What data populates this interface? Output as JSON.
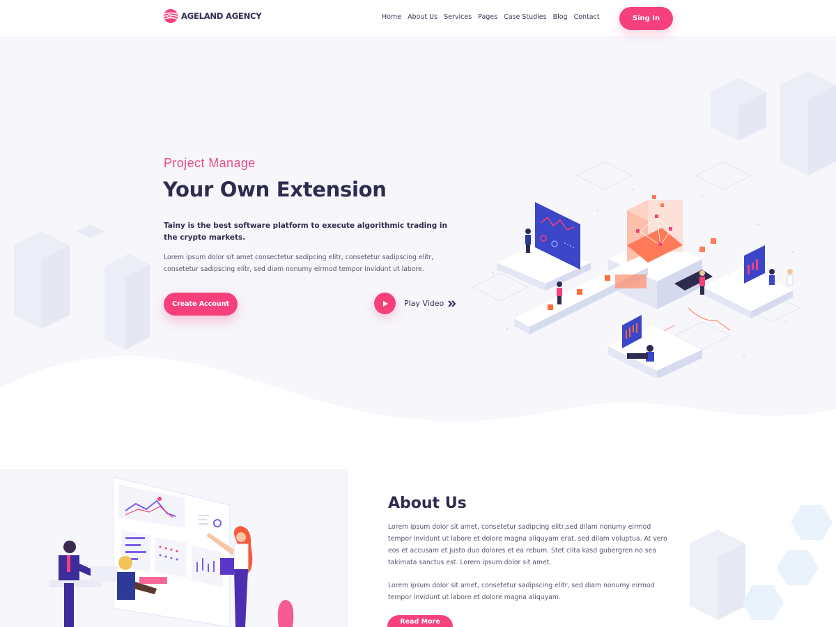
{
  "brand": {
    "name": "AGELAND AGENCY",
    "logo_icon": "globe-logo-icon",
    "accent": "#f5407c",
    "dark": "#2d2c4f"
  },
  "nav": {
    "items": [
      {
        "label": "Home"
      },
      {
        "label": "About Us"
      },
      {
        "label": "Services"
      },
      {
        "label": "Pages"
      },
      {
        "label": "Case Studies"
      },
      {
        "label": "Blog"
      },
      {
        "label": "Contact"
      }
    ],
    "signin_label": "Sing In"
  },
  "hero": {
    "eyebrow": "Project Manage",
    "title": "Your Own Extension",
    "lead": "Tainy is the best software platform to execute algorithmic trading in the crypto markets.",
    "body": "Lorem ipsum dolor sit amet consectetur sadipcing elitr, consetetur sadipscing elitr, consetetur sadipscing elitr, sed diam nonumy eirmod tempor invidunt ut labore.",
    "cta_label": "Create Account",
    "play_label": "Play Video",
    "play_icon": "play-icon",
    "arrows_icon": "double-chevron-right-icon"
  },
  "about": {
    "title": "About Us",
    "paragraph1": "Lorem ipsum dolor sit amet, consetetur sadipcing elitr,sed dilam nonumy eirmod tempor invidunt ut labore et dolore magna aliquyam erat, sed dilam voluptua. At vero eos et accusam et justo duo dolores et ea rebum. Stet clita kasd gubergren no sea takimata sanctus est. Lorem ipsum dolor sit amet.",
    "paragraph2": "Lorem ipsum dolor sit amet, consetetur sadipscing elitr, sed diam nonumy eirmod tempor invidunt ut labore et dolore magna aliquyam.",
    "cta_label": "Read More"
  }
}
